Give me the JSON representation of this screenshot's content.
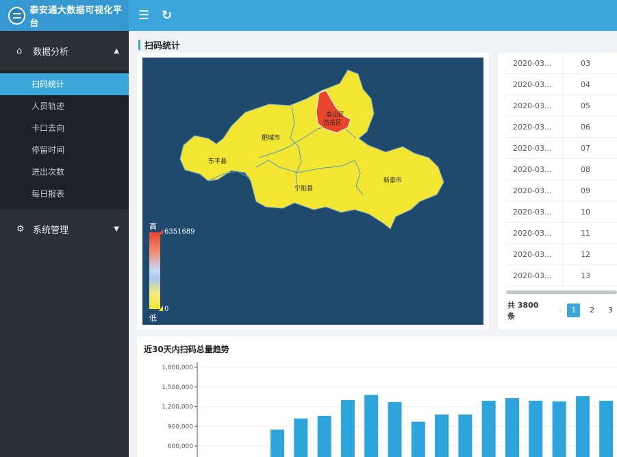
{
  "header": {
    "title": "泰安通大数据可视化平台",
    "icons": {
      "menu": "menu-icon",
      "refresh": "refresh-icon"
    }
  },
  "sidebar": {
    "groups": [
      {
        "label": "数据分析",
        "icon": "home-icon",
        "expanded": true,
        "items": [
          {
            "label": "扫码统计",
            "active": true
          },
          {
            "label": "人员轨迹"
          },
          {
            "label": "卡口去向"
          },
          {
            "label": "停留时间"
          },
          {
            "label": "进出次数"
          },
          {
            "label": "每日报表"
          }
        ]
      },
      {
        "label": "系统管理",
        "icon": "gear-icon",
        "expanded": false
      }
    ]
  },
  "page": {
    "section_title": "扫码统计"
  },
  "map": {
    "legend": {
      "high_label": "高",
      "low_label": "低",
      "max": "6351689",
      "min": "0"
    },
    "regions": [
      "泰山区",
      "岱岳区",
      "肥城市",
      "东平县",
      "宁阳县",
      "新泰市"
    ],
    "colors": {
      "background": "#1f4a6e",
      "low": "#f2e632",
      "high": "#e8452c"
    }
  },
  "table": {
    "rows": [
      {
        "date": "2020-03...",
        "day": "03"
      },
      {
        "date": "2020-03...",
        "day": "04"
      },
      {
        "date": "2020-03...",
        "day": "05"
      },
      {
        "date": "2020-03...",
        "day": "06"
      },
      {
        "date": "2020-03...",
        "day": "07"
      },
      {
        "date": "2020-03...",
        "day": "08"
      },
      {
        "date": "2020-03...",
        "day": "09"
      },
      {
        "date": "2020-03...",
        "day": "10"
      },
      {
        "date": "2020-03...",
        "day": "11"
      },
      {
        "date": "2020-03...",
        "day": "12"
      },
      {
        "date": "2020-03...",
        "day": "13"
      }
    ],
    "pagination": {
      "total": "共 3800 条",
      "prev": "‹",
      "pages": [
        "1",
        "2",
        "3"
      ],
      "current": "1"
    }
  },
  "chart_data": {
    "type": "bar",
    "title": "近30天内扫码总量趋势",
    "ylabel": "",
    "xlabel": "",
    "yticks": [
      "600,000",
      "900,000",
      "1,200,000",
      "1,500,000",
      "1,800,000"
    ],
    "ylim": [
      600000,
      1800000
    ],
    "values": [
      850000,
      1020000,
      1060000,
      1300000,
      1380000,
      1270000,
      970000,
      1080000,
      1080000,
      1290000,
      1330000,
      1290000,
      1280000,
      1360000,
      1290000
    ],
    "color": "#2ea4dc"
  }
}
